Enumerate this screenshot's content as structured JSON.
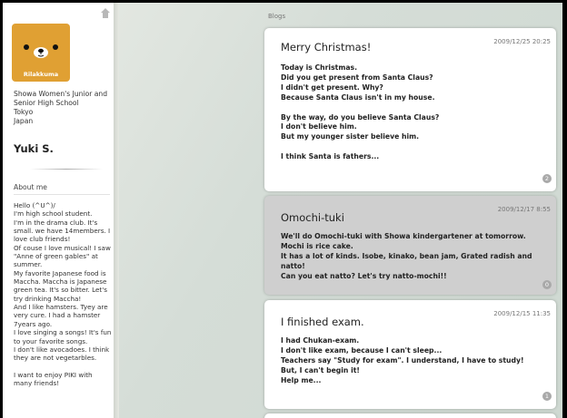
{
  "sidebar": {
    "avatar_brand": "Rilakkuma",
    "school": "Showa Women's Junior and Senior High School",
    "city": "Tokyo",
    "country": "Japan",
    "username": "Yuki S.",
    "about_title": "About me",
    "about_text": "Hello (^U^)/\nI'm high school student.\nI'm in the drama club. It's small. we have 14members. I love club friends!\nOf couse I love musical! I saw \"Anne of green gables\" at summer.\nMy favorite Japanese food is Maccha. Maccha is Japanese green tea. It's so bitter. Let's try drinking Maccha!\nAnd I like hamsters. Tyey are very cure. I had a hamster 7years ago.\nI love singing a songs! It's fun to your favorite songs.\nI don't like avocadoes. I think they are not vegetarbles.\n\nI want to enjoy PIKI with many friends!",
    "home_icon": "home-icon"
  },
  "blogs": {
    "section_title": "Blogs",
    "posts": [
      {
        "title": "Merry Christmas!",
        "date": "2009/12/25 20:25",
        "body": "Today is Christmas.\nDid you get present from Santa Claus?\nI didn't get present. Why?\nBecause Santa Claus isn't in my house.\n\nBy the way, do you believe Santa Claus?\nI don't believe him.\nBut my younger sister believe him.\n\nI think Santa is fathers...",
        "comments": "2"
      },
      {
        "title": "Omochi-tuki",
        "date": "2009/12/17 8:55",
        "body": "We'll do Omochi-tuki with Showa kindergartener at tomorrow.\nMochi is rice cake.\nIt has a lot of kinds. Isobe, kinako, bean jam, Grated radish and natto!\nCan you eat natto? Let's try natto-mochi!!",
        "comments": "0"
      },
      {
        "title": "I finished exam.",
        "date": "2009/12/15 11:35",
        "body": "I had Chukan-exam.\nI don't like exam, because I can't sleep...\nTeachers say \"Study for exam\". I understand, I have to study!\nBut, I can't begin it!\nHelp me...",
        "comments": "1"
      }
    ]
  },
  "colors": {
    "post_default": "#ffffff",
    "post_highlight": "#cfcfcf",
    "avatar_bg": "#e0a033",
    "badge": "#a9a9a9"
  }
}
